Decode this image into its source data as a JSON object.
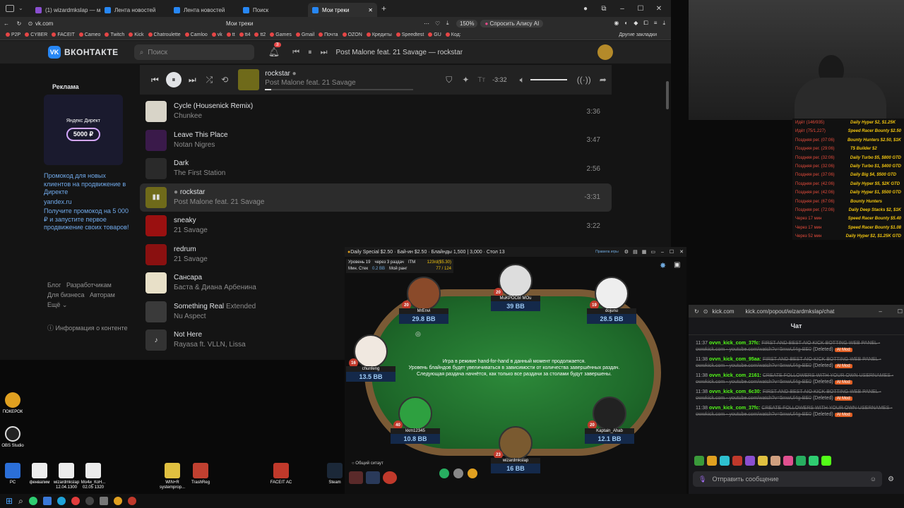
{
  "browser": {
    "tabs": [
      {
        "label": "(1) wizardmkslap — менеджер"
      },
      {
        "label": "Лента новостей"
      },
      {
        "label": "Лента новостей"
      },
      {
        "label": "Поиск"
      },
      {
        "label": "Мои треки"
      }
    ],
    "url": "vk.com",
    "page_title": "Мои треки",
    "zoom": "150%",
    "alice_label": "Спросить Алису AI",
    "bookmarks": [
      "P2P",
      "CYBER",
      "FACEIT",
      "Cameo",
      "Twitch",
      "Kick",
      "Chatroulette",
      "Camloo",
      "vk",
      "tt",
      "tt4",
      "tt2",
      "Games",
      "Gmail",
      "Почта",
      "OZON",
      "Кредиты",
      "Speedtest",
      "GU",
      "Код:"
    ],
    "other_bookmarks": "Другие закладки"
  },
  "vk": {
    "logo": "ВКОНТАКТЕ",
    "search_placeholder": "Поиск",
    "notif_count": "3",
    "header_track": "Post Malone feat. 21 Savage — rockstar",
    "player": {
      "title": "rockstar",
      "artist": "Post Malone feat. 21 Savage",
      "remaining": "-3:32"
    },
    "ad": {
      "label": "Реклама",
      "brand": "Яндекс Директ",
      "amount": "5000 ₽",
      "headline": "Промокод для новых клиентов на продвижение в Директе",
      "domain": "yandex.ru",
      "body": "Получите промокод на 5 000 ₽ и запустите первое продвижение своих товаров!"
    },
    "footer_links": {
      "blog": "Блог",
      "dev": "Разработчикам",
      "biz": "Для бизнеса",
      "authors": "Авторам",
      "more": "Ещё",
      "info": "Информация о контенте"
    },
    "tracks": [
      {
        "title": "Cycle (Housenick Remix)",
        "extra": "",
        "artist": "Chunkee",
        "duration": "3:36"
      },
      {
        "title": "Leave This Place",
        "extra": "",
        "artist": "Notan Nigres",
        "duration": "3:47"
      },
      {
        "title": "Dark",
        "extra": "",
        "artist": "The First Station",
        "duration": "2:56"
      },
      {
        "title": "rockstar",
        "extra": "",
        "artist": "Post Malone feat. 21 Savage",
        "duration": "-3:31"
      },
      {
        "title": "sneaky",
        "extra": "",
        "artist": "21 Savage",
        "duration": "3:22"
      },
      {
        "title": "redrum",
        "extra": "",
        "artist": "21 Savage",
        "duration": ""
      },
      {
        "title": "Сансара",
        "extra": "",
        "artist": "Баста & Диана Арбенина",
        "duration": ""
      },
      {
        "title": "Something Real",
        "extra": "Extended",
        "artist": "Nu Aspect",
        "duration": ""
      },
      {
        "title": "Not Here",
        "extra": "",
        "artist": "Rayasa ft. VLLN, Lissa",
        "duration": ""
      }
    ]
  },
  "desktop": {
    "icons_left": [
      {
        "label": "ПОКЕРОК"
      },
      {
        "label": "OBS Studio"
      }
    ],
    "icons_bottom": [
      {
        "label": "PC"
      },
      {
        "label": "фенвапим"
      },
      {
        "label": "wizardmkslap 12.04.1300"
      },
      {
        "label": "Мо4и_КоН... 02.05 1320"
      },
      {
        "label": "WIN+R systemprop..."
      },
      {
        "label": "TrashReg"
      },
      {
        "label": "FACEIT AC"
      },
      {
        "label": "Steam"
      }
    ]
  },
  "poker": {
    "title": "Daily Special $2.50 · Бай-ин $2.50 · Блайнды 1,500 | 3,000 · Стол 13",
    "rules_link": "Правила игры",
    "info": {
      "level": "Уровень 19",
      "next": "через 3 раздач",
      "itm": "ITM",
      "prize": "123rd($5.30)",
      "min_stack_label": "Мин. Стек",
      "min_stack": "0.2 BB",
      "rank_label": "Мой ранг",
      "rank": "77 / 124"
    },
    "message": [
      "Игра в режиме hand-for-hand в данный момент продолжается.",
      "Уровень блайндов будет увеличиваться в зависимости от количества завершённых раздач.",
      "Следующая раздача начнётся, как только все раздачи за столами будут завершены."
    ],
    "players": [
      {
        "name": "MrEnvi",
        "bb": "29.8 BB",
        "lvl": "20"
      },
      {
        "name": "MuKPOCbI MOu",
        "bb": "39 BB",
        "lvl": "20"
      },
      {
        "name": "dojunu",
        "bb": "28.5 BB",
        "lvl": "19"
      },
      {
        "name": "chunfeng",
        "bb": "13.5 BB",
        "lvl": "16"
      },
      {
        "name": "kkm12345",
        "bb": "10.8 BB",
        "lvl": "40"
      },
      {
        "name": "Kaptain_Ahab",
        "bb": "12.1 BB",
        "lvl": "20"
      },
      {
        "name": "wizardmkslap",
        "bb": "16 BB",
        "lvl": "23"
      }
    ],
    "chat_label": "Общий ситаут"
  },
  "tournaments": [
    {
      "left": "Идёт (146/935)",
      "right": "Daily Hyper $2, $1.25K"
    },
    {
      "left": "Идёт (75/1,227)",
      "right": "Speed Racer Bounty $2.50"
    },
    {
      "left": "Поздняя рег. (07:06)",
      "right": "Bounty Hunters $2.50, $1K"
    },
    {
      "left": "Поздняя рег. (29:06)",
      "right": "T$ Builder $2"
    },
    {
      "left": "Поздняя рег. (32:06)",
      "right": "Daily Turbo $5, $800 GTD"
    },
    {
      "left": "Поздняя рег. (32:06)",
      "right": "Daily Turbo $1, $400 GTD"
    },
    {
      "left": "Поздняя рег. (37:06)",
      "right": "Daily Big $4, $500 GTD"
    },
    {
      "left": "Поздняя рег. (42:06)",
      "right": "Daily Hyper $5, $2K GTD"
    },
    {
      "left": "Поздняя рег. (42:06)",
      "right": "Daily Hyper $1, $500 GTD"
    },
    {
      "left": "Поздняя рег. (67:06)",
      "right": "Bounty Hunters"
    },
    {
      "left": "Поздняя рег. (72:06)",
      "right": "Daily Deep Stacks $2, $1K"
    },
    {
      "left": "Через 17 мин",
      "right": "Speed Racer Bounty $5.40"
    },
    {
      "left": "Через 17 мин",
      "right": "Speed Racer Bounty $1.08"
    },
    {
      "left": "Через 52 мин",
      "right": "Daily Hyper $2, $1.25K GTD"
    }
  ],
  "kick": {
    "url_short": "kick.com",
    "url": "kick.com/popout/wizardmkslap/chat",
    "header": "Чат",
    "messages": [
      {
        "time": "11:37",
        "user": "ovvn_kick_com_37fc:",
        "text": "FIRST AND BEST AIO KICK BOTTING WEB PANEL - owwkick.com - youtube.com/watch?v=5mwUl4g-BE0",
        "deleted": "(Deleted)",
        "tag": "AI Mod"
      },
      {
        "time": "11:38",
        "user": "ovvn_kick_com_95aa:",
        "text": "FIRST AND BEST AIO KICK BOTTING WEB PANEL - owwkick.com - youtube.com/watch?v=5mwUl4g-BE0",
        "deleted": "(Deleted)",
        "tag": "AI Mod"
      },
      {
        "time": "11:38",
        "user": "ovvn_kick_com_2161:",
        "text": "CREATE FOLLOWERS WITH YOUR OWN USERNAMES - owwkick.com - youtube.com/watch?v=5mwUl4g-BE0",
        "deleted": "(Deleted)",
        "tag": "AI Mod"
      },
      {
        "time": "11:38",
        "user": "ovvn_kick_com_6c30:",
        "text": "FIRST AND BEST AIO KICK BOTTING WEB PANEL - owwkick.com - youtube.com/watch?v=5mwUl4g-BE0",
        "deleted": "(Deleted)",
        "tag": "AI Mod"
      },
      {
        "time": "11:38",
        "user": "ovvn_kick_com_37fc:",
        "text": "CREATE FOLLOWERS WITH YOUR OWN USERNAMES - owwkick.com - youtube.com/watch?v=5mwUl4g-BE0",
        "deleted": "(Deleted)",
        "tag": "AI Mod"
      }
    ],
    "input_placeholder": "Отправить сообщение"
  }
}
